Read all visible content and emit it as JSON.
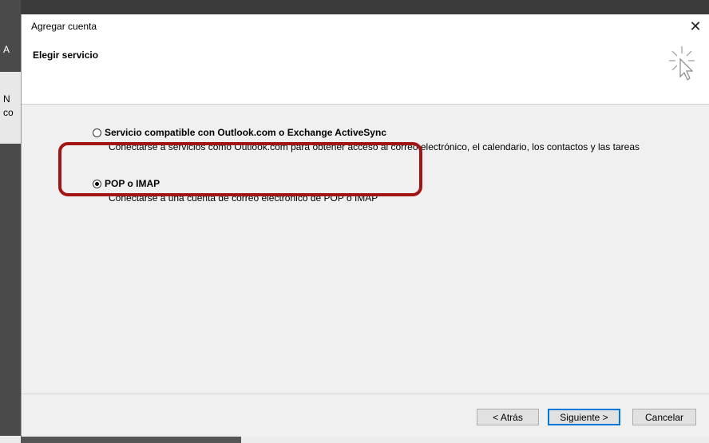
{
  "background": {
    "left_chars": [
      "A",
      "N",
      "co"
    ]
  },
  "dialog": {
    "title": "Agregar cuenta",
    "close_glyph": "✕",
    "header_title": "Elegir servicio",
    "header_icon": "cursor-sparkle-icon"
  },
  "options": [
    {
      "label": "Servicio compatible con Outlook.com o Exchange ActiveSync",
      "description": "Conectarse a servicios como Outlook.com para obtener acceso al correo electrónico, el calendario, los contactos y las tareas",
      "selected": false
    },
    {
      "label": "POP o IMAP",
      "description": "Conectarse a una cuenta de correo electrónico de POP o IMAP",
      "selected": true
    }
  ],
  "buttons": {
    "back": "< Atrás",
    "next": "Siguiente >",
    "cancel": "Cancelar"
  },
  "colors": {
    "highlight": "#a31515",
    "default_button_border": "#0078d7"
  }
}
